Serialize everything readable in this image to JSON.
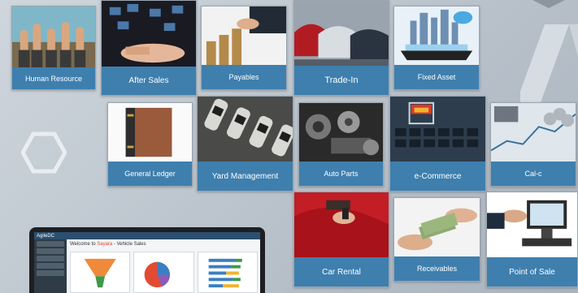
{
  "tiles": [
    {
      "key": "hr",
      "label": "Human Resource"
    },
    {
      "key": "aftersales",
      "label": "After Sales"
    },
    {
      "key": "payables",
      "label": "Payables"
    },
    {
      "key": "tradein",
      "label": "Trade-In"
    },
    {
      "key": "fixedasset",
      "label": "Fixed Asset"
    },
    {
      "key": "ledger",
      "label": "General Ledger"
    },
    {
      "key": "yard",
      "label": "Yard Management"
    },
    {
      "key": "autoparts",
      "label": "Auto Parts"
    },
    {
      "key": "ecommerce",
      "label": "e-Commerce"
    },
    {
      "key": "calc",
      "label": "Cal-c"
    },
    {
      "key": "carrental",
      "label": "Car Rental"
    },
    {
      "key": "receivables",
      "label": "Receivables"
    },
    {
      "key": "pos",
      "label": "Point of Sale"
    }
  ],
  "preview": {
    "brand": "AgileDC",
    "title_prefix": "Welcome to ",
    "title_accent": "Sayara",
    "title_suffix": " - Vehicle Sales"
  },
  "colors": {
    "tile_label_bg": "#3e7fae",
    "accent": "#e0452a"
  }
}
